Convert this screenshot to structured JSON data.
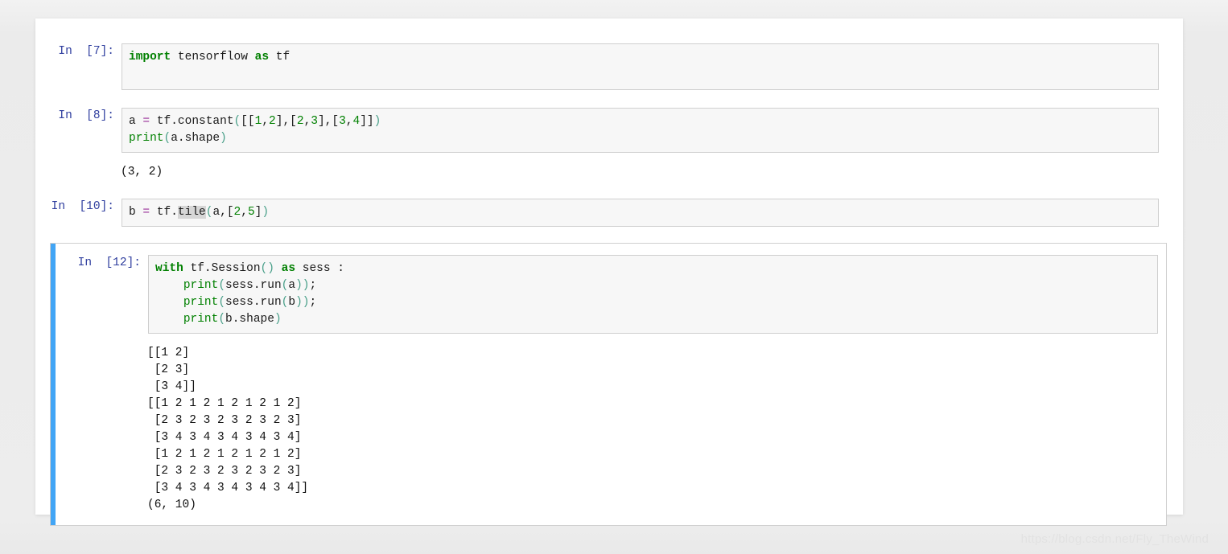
{
  "page": {
    "background_color": "#ececec",
    "paper_color": "#ffffff",
    "watermark": "https://blog.csdn.net/Fly_TheWind"
  },
  "theme": {
    "prompt_color": "#303f9f",
    "keyword_color": "#008000",
    "number_color": "#008000",
    "operator_color": "#9a309a",
    "punctuation_color": "#4aa08a",
    "selection_bar_color": "#42a5f5",
    "input_background": "#f7f7f7",
    "input_border": "#cfcfcf",
    "highlight_background": "#d6d6d6"
  },
  "cells": [
    {
      "prompt": "In  [7]:",
      "execution_count": "7",
      "selected": false,
      "code_lines": [
        "import tensorflow as tf"
      ],
      "output": null
    },
    {
      "prompt": "In  [8]:",
      "execution_count": "8",
      "selected": false,
      "code_lines": [
        "a = tf.constant([[1,2],[2,3],[3,4]])",
        "print(a.shape)"
      ],
      "output": "(3, 2)"
    },
    {
      "prompt": "In  [10]:",
      "execution_count": "10",
      "selected": false,
      "code_lines": [
        "b = tf.tile(a,[2,5])"
      ],
      "output": null
    },
    {
      "prompt": "In  [12]:",
      "execution_count": "12",
      "selected": true,
      "code_lines": [
        "with tf.Session() as sess :",
        "    print(sess.run(a));",
        "    print(sess.run(b));",
        "    print(b.shape)"
      ],
      "output": "[[1 2]\n [2 3]\n [3 4]]\n[[1 2 1 2 1 2 1 2 1 2]\n [2 3 2 3 2 3 2 3 2 3]\n [3 4 3 4 3 4 3 4 3 4]\n [1 2 1 2 1 2 1 2 1 2]\n [2 3 2 3 2 3 2 3 2 3]\n [3 4 3 4 3 4 3 4 3 4]]\n(6, 10)"
    }
  ]
}
